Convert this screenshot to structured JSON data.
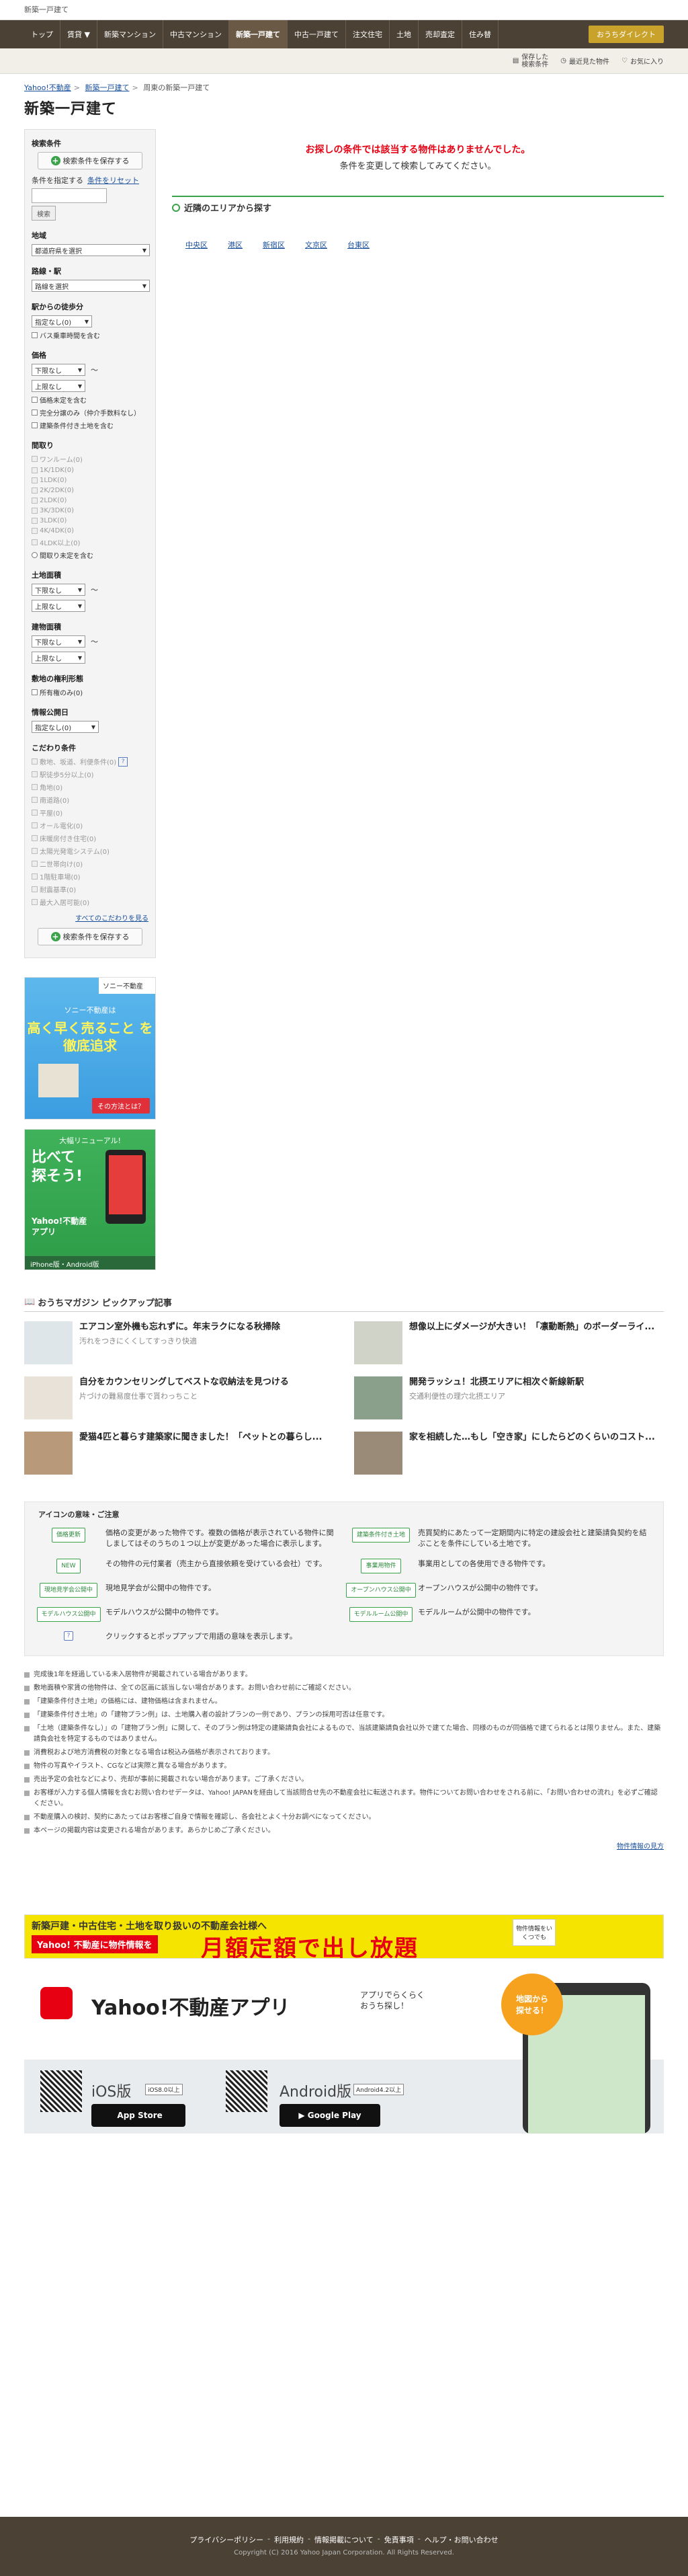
{
  "topstrip": {
    "text": "新築一戸建て"
  },
  "gnav": {
    "items": [
      "トップ",
      "賃貸 ▼",
      "新築マンション",
      "中古マンション",
      "新築一戸建て",
      "中古一戸建て",
      "注文住宅",
      "土地",
      "売却査定",
      "住み替"
    ],
    "active_index": 4,
    "direct": "おうちダイレクト"
  },
  "subnav": {
    "saved": "保存した\n検索条件",
    "nearby": "最近見た物件",
    "favorites": "お気に入り"
  },
  "breadcrumb": [
    "Yahoo!不動産",
    "新築一戸建て",
    "周東の新築一戸建て"
  ],
  "page_title": "新築一戸建て",
  "side": {
    "search_cond": "検索条件",
    "save_cond": "検索条件を保存する",
    "kw_label": "条件を指定する",
    "reset_label": "条件をリセット",
    "search_btn": "検索",
    "region_label": "地域",
    "region_select": "都道府県を選択",
    "route_label": "路線・駅",
    "route_select": "路線を選択",
    "walk_label": "駅からの徒歩分",
    "walk_select": "指定なし(0)",
    "walk_bus": "バス乗車時間を含む",
    "price_label": "価格",
    "price_lower": "下限なし",
    "price_upper": "上限なし",
    "price_tilde": "〜",
    "price_undecided": "価格未定を含む",
    "price_all_in": "完全分譲のみ（仲介手数料なし）",
    "price_cond": "建築条件付き土地を含む",
    "layout_label": "間取り",
    "layouts": [
      "ワンルーム(0)",
      "1K/1DK(0)",
      "1LDK(0)",
      "2K/2DK(0)",
      "2LDK(0)",
      "3K/3DK(0)",
      "3LDK(0)",
      "4K/4DK(0)",
      "4LDK以上(0)"
    ],
    "layout_undecided": "間取り未定を含む",
    "land_label": "土地面積",
    "land_lower": "下限なし",
    "land_upper": "上限なし",
    "bldg_label": "建物面積",
    "bldg_lower": "下限なし",
    "bldg_upper": "上限なし",
    "rights_label": "敷地の権利形態",
    "rights_own": "所有権のみ(0)",
    "date_label": "情報公開日",
    "date_select": "指定なし(0)",
    "detail_label": "こだわり条件",
    "details": [
      "敷地、坂道、利便条件(0)",
      "駅徒歩5分以上(0)",
      "角地(0)",
      "南道路(0)",
      "平屋(0)",
      "オール電化(0)",
      "床暖房付き住宅(0)",
      "太陽光発電システム(0)",
      "二世帯向け(0)",
      "1階駐車場(0)",
      "耐震基準(0)",
      "最大入居可能(0)"
    ],
    "all_details": "すべてのこだわりを見る",
    "save_cond2": "検索条件を保存する"
  },
  "ad_sony": {
    "logo": "ソニー不動産",
    "line1": "ソニー不動産は",
    "line2": "高く早く売ること を\n徹底追求",
    "cta": "その方法とは？"
  },
  "ad_app": {
    "top": "大幅リニューアル!",
    "big": "比べて\n探そう!",
    "name": "Yahoo!不動産\nアプリ",
    "bottom": "iPhone版・Android版"
  },
  "main": {
    "no_result_1": "お探しの条件では該当する物件はありませんでした。",
    "no_result_2": "条件を変更して検索してみてください。",
    "nearby_title": "近隣のエリアから探す",
    "nearby_areas": [
      "中央区",
      "港区",
      "新宿区",
      "文京区",
      "台東区"
    ]
  },
  "magazine": {
    "title": "おうちマガジン ピックアップ記事",
    "articles": [
      {
        "title": "エアコン室外機も忘れずに。年末ラクになる秋掃除",
        "sub": "汚れをつきにくくしてすっきり快適"
      },
      {
        "title": "想像以上にダメージが大きい！「凛動断熱」のボーダーライ...",
        "sub": ""
      },
      {
        "title": "自分をカウンセリングしてベストな収納法を見つける",
        "sub": "片づけの難易度仕事で貰わっちこと"
      },
      {
        "title": "開発ラッシュ！北摂エリアに相次ぐ新線新駅",
        "sub": "交通利便性の理穴北摂エリア"
      },
      {
        "title": "愛猫4匹と暮らす建築家に聞きました！「ペットとの暮らし...",
        "sub": ""
      },
      {
        "title": "家を相続した…もし「空き家」にしたらどのくらいのコスト...",
        "sub": ""
      }
    ]
  },
  "icons": {
    "title": "アイコンの意味・ご注意",
    "items": [
      {
        "tag": "価格更新",
        "text": "価格の変更があった物件です。複数の価格が表示されている物件に関しましてはそのうちの１つ以上が変更があった場合に表示します。"
      },
      {
        "tag": "建築条件付き土地",
        "text": "売買契約にあたって一定期間内に特定の建設会社と建築請負契約を結ぶことを条件にしている土地です。"
      },
      {
        "tag": "NEW",
        "text": "その物件の元付業者（売主から直接依頼を受けている会社）です。"
      },
      {
        "tag": "事業用物件",
        "text": "事業用としての各使用できる物件です。"
      },
      {
        "tag": "現地見学会公開中",
        "text": "現地見学会が公開中の物件です。"
      },
      {
        "tag": "オープンハウス公開中",
        "text": "オープンハウスが公開中の物件です。"
      },
      {
        "tag": "モデルハウス公開中",
        "text": "モデルハウスが公開中の物件です。"
      },
      {
        "tag": "モデルルーム公開中",
        "text": "モデルルームが公開中の物件です。"
      },
      {
        "tag": "?",
        "text": "クリックするとポップアップで用語の意味を表示します。"
      }
    ]
  },
  "notes": {
    "items": [
      "完成後1年を経過している未入居物件が掲載されている場合があります。",
      "敷地面積や家賃の他物件は、全ての区画に該当しない場合があります。お問い合わせ前にご確認ください。",
      "「建築条件付き土地」の価格には、建物価格は含まれません。",
      "「建築条件付き土地」の「建物プラン例」は、土地購入者の設計プランの一例であり、プランの採用可否は任意です。",
      "「土地（建築条件なし）」の「建物プラン例」に関して、そのプラン例は特定の建築請負会社によるもので、当該建築請負会社以外で建てた場合、同様のものが同価格で建てられるとは限りません。また、建築請負会社を特定するものではありません。",
      "消費税および地方消費税の対象となる場合は税込み価格が表示されております。",
      "物件の写真やイラスト、CGなどは実際と異なる場合があります。",
      "売出予定の会社などにより、売却が事前に掲載されない場合があります。ご了承ください。",
      "お客様が入力する個人情報を含むお問い合わせデータは、Yahoo! JAPANを経由して当該問合せ先の不動産会社に転送されます。物件についてお問い合わせをされる前に、「お問い合わせの流れ」を必ずご確認ください。",
      "不動産購入の検討、契約にあたってはお客様ご自身で情報を確認し、各会社とよく十分お調べになってください。",
      "本ページの掲載内容は変更される場合があります。あらかじめご了承ください。"
    ],
    "link_text": "お問い合わせの流れ",
    "more": "物件情報の見方"
  },
  "banner": {
    "line1": "新築戸建・中古住宅・土地を取り扱いの不動産会社様へ",
    "yahoo": "Yahoo! 不動産に物件情報を",
    "big": "月額定額で出し放題",
    "box": "物件情報をいくつでも"
  },
  "appban": {
    "title": "Yahoo!不動産アプリ",
    "sub": "アプリでらくらく\nおうち探し！",
    "ios": "iOS版",
    "ios_ver": "iOS8.0以上",
    "android": "Android版",
    "android_ver": "Android4.2以上",
    "appstore": "App Store",
    "googleplay": "Google Play",
    "bubble": "地図から\n探せる！"
  },
  "footer": {
    "links": [
      "プライバシーポリシー",
      "利用規約",
      "情報掲載について",
      "免責事項",
      "ヘルプ・お問い合わせ"
    ],
    "copy": "Copyright (C) 2016 Yahoo Japan Corporation. All Rights Reserved."
  },
  "colors": {
    "nav_bg": "#4b4134",
    "accent_green": "#3aa34a",
    "alert_red": "#e60012",
    "direct_gold": "#c9a22c"
  }
}
